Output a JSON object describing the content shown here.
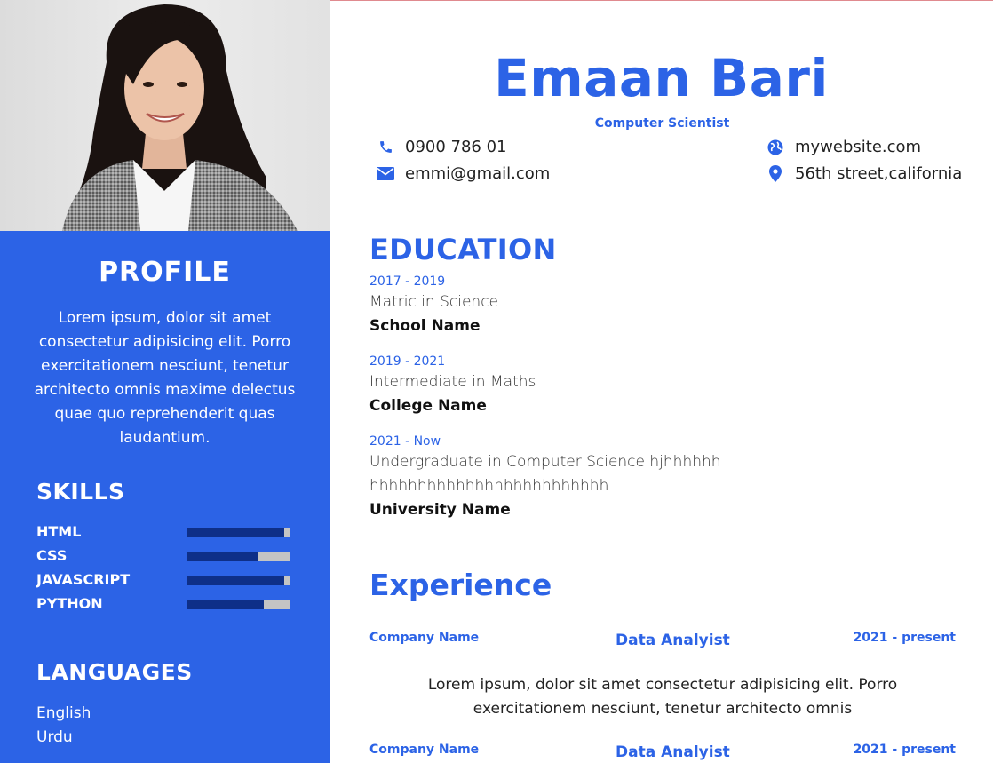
{
  "resume": {
    "name": "Emaan Bari",
    "job_title": "Computer Scientist"
  },
  "contact": {
    "phone": "0900 786 01",
    "email": "emmi@gmail.com",
    "website": "mywebsite.com",
    "address": "56th street,california",
    "icons": {
      "phone": "phone-icon",
      "email": "envelope-icon",
      "website": "globe-icon",
      "address": "map-pin-icon"
    }
  },
  "sidebar": {
    "photo": "portrait-photo",
    "profile": {
      "title": "PROFILE",
      "text": "Lorem ipsum, dolor sit amet consectetur adipisicing elit. Porro exercitationem nesciunt, tenetur architecto omnis maxime delectus quae quo reprehenderit quas laudantium."
    },
    "skills": {
      "title": "SKILLS",
      "items": [
        {
          "name": "HTML",
          "level": 0.95
        },
        {
          "name": "CSS",
          "level": 0.7
        },
        {
          "name": "JAVASCRIPT",
          "level": 0.95
        },
        {
          "name": "PYTHON",
          "level": 0.75
        }
      ]
    },
    "languages": {
      "title": "LANGUAGES",
      "items": [
        "English",
        "Urdu"
      ]
    }
  },
  "education": {
    "title": "EDUCATION",
    "items": [
      {
        "years": "2017 - 2019",
        "degree": "Matric in Science",
        "school": "School Name"
      },
      {
        "years": "2019 - 2021",
        "degree": "Intermediate in Maths",
        "school": "College Name"
      },
      {
        "years": "2021 - Now",
        "degree": "Undergraduate in Computer Science hjhhhhhhhhhhhhhhhhhhhhhhhhhhhhhhh",
        "school": "University Name"
      }
    ]
  },
  "experience": {
    "title": "Experience",
    "items": [
      {
        "company": "Company Name",
        "role": "Data Analyist",
        "dates": "2021 - present",
        "description": "Lorem ipsum, dolor sit amet consectetur adipisicing elit. Porro exercitationem nesciunt, tenetur architecto omnis"
      },
      {
        "company": "Company Name",
        "role": "Data Analyist",
        "dates": "2021 - present"
      }
    ]
  },
  "colors": {
    "accent": "#2c63e6",
    "skill_fill": "#0e2f88",
    "skill_track": "#c4c4c4"
  }
}
